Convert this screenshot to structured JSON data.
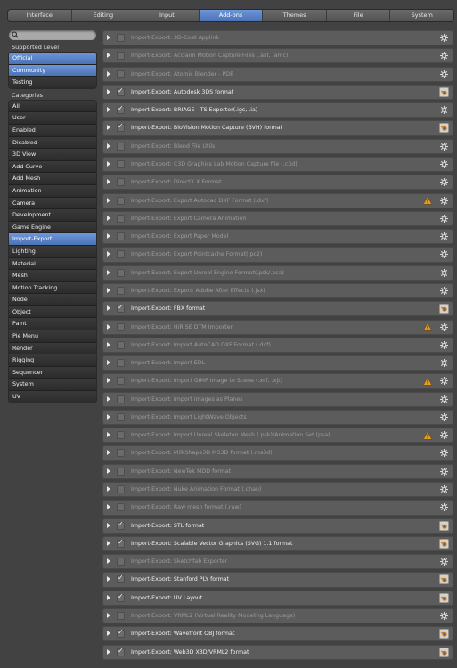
{
  "tabs": [
    {
      "label": "Interface",
      "active": false
    },
    {
      "label": "Editing",
      "active": false
    },
    {
      "label": "Input",
      "active": false
    },
    {
      "label": "Add-ons",
      "active": true
    },
    {
      "label": "Themes",
      "active": false
    },
    {
      "label": "File",
      "active": false
    },
    {
      "label": "System",
      "active": false
    }
  ],
  "search": {
    "placeholder": ""
  },
  "supported_level": {
    "label": "Supported Level",
    "items": [
      {
        "label": "Official",
        "selected": true
      },
      {
        "label": "Community",
        "selected": true
      },
      {
        "label": "Testing",
        "selected": false
      }
    ]
  },
  "categories": {
    "label": "Categories",
    "items": [
      {
        "label": "All",
        "selected": false
      },
      {
        "label": "User",
        "selected": false
      },
      {
        "label": "Enabled",
        "selected": false
      },
      {
        "label": "Disabled",
        "selected": false
      },
      {
        "label": "3D View",
        "selected": false
      },
      {
        "label": "Add Curve",
        "selected": false
      },
      {
        "label": "Add Mesh",
        "selected": false
      },
      {
        "label": "Animation",
        "selected": false
      },
      {
        "label": "Camera",
        "selected": false
      },
      {
        "label": "Development",
        "selected": false
      },
      {
        "label": "Game Engine",
        "selected": false
      },
      {
        "label": "Import-Export",
        "selected": true
      },
      {
        "label": "Lighting",
        "selected": false
      },
      {
        "label": "Material",
        "selected": false
      },
      {
        "label": "Mesh",
        "selected": false
      },
      {
        "label": "Motion Tracking",
        "selected": false
      },
      {
        "label": "Node",
        "selected": false
      },
      {
        "label": "Object",
        "selected": false
      },
      {
        "label": "Paint",
        "selected": false
      },
      {
        "label": "Pie Menu",
        "selected": false
      },
      {
        "label": "Render",
        "selected": false
      },
      {
        "label": "Rigging",
        "selected": false
      },
      {
        "label": "Sequencer",
        "selected": false
      },
      {
        "label": "System",
        "selected": false
      },
      {
        "label": "UV",
        "selected": false
      }
    ]
  },
  "addons": [
    {
      "name": "Import-Export: 3D-Coat Applink",
      "enabled": false,
      "warning": false,
      "icon": "gear-icon"
    },
    {
      "name": "Import-Export: Acclaim Motion Capture Files (.asf, .amc)",
      "enabled": false,
      "warning": false,
      "icon": "gear-icon"
    },
    {
      "name": "Import-Export: Atomic Blender - PDB",
      "enabled": false,
      "warning": false,
      "icon": "gear-icon"
    },
    {
      "name": "Import-Export: Autodesk 3DS format",
      "enabled": true,
      "warning": false,
      "icon": "blender-icon"
    },
    {
      "name": "Import-Export: BRIAGE - TS Exporter(.igs, .ia)",
      "enabled": true,
      "warning": false,
      "icon": "gear-icon"
    },
    {
      "name": "Import-Export: BioVision Motion Capture (BVH) format",
      "enabled": true,
      "warning": false,
      "icon": "blender-icon"
    },
    {
      "name": "Import-Export: Blend File Utils",
      "enabled": false,
      "warning": false,
      "icon": "gear-icon"
    },
    {
      "name": "Import-Export: C3D Graphics Lab Motion Capture file (.c3d)",
      "enabled": false,
      "warning": false,
      "icon": "gear-icon"
    },
    {
      "name": "Import-Export: DirectX X Format",
      "enabled": false,
      "warning": false,
      "icon": "gear-icon"
    },
    {
      "name": "Import-Export: Export Autocad DXF Format (.dxf)",
      "enabled": false,
      "warning": true,
      "icon": "gear-icon"
    },
    {
      "name": "Import-Export: Export Camera Animation",
      "enabled": false,
      "warning": false,
      "icon": "gear-icon"
    },
    {
      "name": "Import-Export: Export Paper Model",
      "enabled": false,
      "warning": false,
      "icon": "gear-icon"
    },
    {
      "name": "Import-Export: Export Pointcache Format(.pc2)",
      "enabled": false,
      "warning": false,
      "icon": "gear-icon"
    },
    {
      "name": "Import-Export: Export Unreal Engine Format(.psk/.psa)",
      "enabled": false,
      "warning": false,
      "icon": "gear-icon"
    },
    {
      "name": "Import-Export: Export: Adobe After Effects (.jsx)",
      "enabled": false,
      "warning": false,
      "icon": "gear-icon"
    },
    {
      "name": "Import-Export: FBX format",
      "enabled": true,
      "warning": false,
      "icon": "blender-icon"
    },
    {
      "name": "Import-Export: HiRISE DTM Importer",
      "enabled": false,
      "warning": true,
      "icon": "gear-icon"
    },
    {
      "name": "Import-Export: Import AutoCAD DXF Format (.dxf)",
      "enabled": false,
      "warning": false,
      "icon": "gear-icon"
    },
    {
      "name": "Import-Export: Import EDL",
      "enabled": false,
      "warning": false,
      "icon": "gear-icon"
    },
    {
      "name": "Import-Export: Import GIMP Image to Scene (.xcf, .xjt)",
      "enabled": false,
      "warning": true,
      "icon": "gear-icon"
    },
    {
      "name": "Import-Export: Import Images as Planes",
      "enabled": false,
      "warning": false,
      "icon": "gear-icon"
    },
    {
      "name": "Import-Export: Import LightWave Objects",
      "enabled": false,
      "warning": false,
      "icon": "gear-icon"
    },
    {
      "name": "Import-Export: Import Unreal Skeleton Mesh (.psk)/Animation Set (psa)",
      "enabled": false,
      "warning": true,
      "icon": "gear-icon"
    },
    {
      "name": "Import-Export: MilkShape3D MS3D format (.ms3d)",
      "enabled": false,
      "warning": false,
      "icon": "gear-icon"
    },
    {
      "name": "Import-Export: NewTek MDD format",
      "enabled": false,
      "warning": false,
      "icon": "gear-icon"
    },
    {
      "name": "Import-Export: Nuke Animation Format (.chan)",
      "enabled": false,
      "warning": false,
      "icon": "gear-icon"
    },
    {
      "name": "Import-Export: Raw mesh format (.raw)",
      "enabled": false,
      "warning": false,
      "icon": "gear-icon"
    },
    {
      "name": "Import-Export: STL format",
      "enabled": true,
      "warning": false,
      "icon": "blender-icon"
    },
    {
      "name": "Import-Export: Scalable Vector Graphics (SVG) 1.1 format",
      "enabled": true,
      "warning": false,
      "icon": "blender-icon"
    },
    {
      "name": "Import-Export: Sketchfab Exporter",
      "enabled": false,
      "warning": false,
      "icon": "gear-icon"
    },
    {
      "name": "Import-Export: Stanford PLY format",
      "enabled": true,
      "warning": false,
      "icon": "blender-icon"
    },
    {
      "name": "Import-Export: UV Layout",
      "enabled": true,
      "warning": false,
      "icon": "blender-icon"
    },
    {
      "name": "Import-Export: VRML2 (Virtual Reality Modeling Language)",
      "enabled": false,
      "warning": false,
      "icon": "gear-icon"
    },
    {
      "name": "Import-Export: Wavefront OBJ format",
      "enabled": true,
      "warning": false,
      "icon": "blender-icon"
    },
    {
      "name": "Import-Export: Web3D X3D/VRML2 format",
      "enabled": true,
      "warning": false,
      "icon": "blender-icon"
    }
  ]
}
